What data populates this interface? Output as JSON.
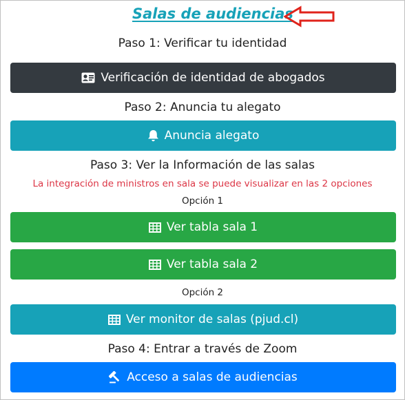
{
  "page": {
    "title": "Salas de audiencias",
    "colors": {
      "title": "#17a2b8",
      "arrow": "#e0231b",
      "note": "#dc3545",
      "dark": "#343a40",
      "info": "#17a2b8",
      "success": "#28a745",
      "primary": "#007bff"
    }
  },
  "step1": {
    "heading": "Paso 1: Verificar tu identidad",
    "button": {
      "label": "Verificación de identidad de abogados",
      "icon": "id-card-icon"
    }
  },
  "step2": {
    "heading": "Paso 2: Anuncia tu alegato",
    "button": {
      "label": "Anuncia alegato",
      "icon": "bell-icon"
    }
  },
  "step3": {
    "heading": "Paso 3: Ver la Información de las salas",
    "note": "La integración de ministros en sala se puede visualizar en las 2 opciones",
    "option1": {
      "label": "Opción 1",
      "buttons": [
        {
          "label": "Ver tabla sala 1",
          "icon": "table-icon"
        },
        {
          "label": "Ver tabla sala 2",
          "icon": "table-icon"
        }
      ]
    },
    "option2": {
      "label": "Opción 2",
      "button": {
        "label": "Ver monitor de salas (pjud.cl)",
        "icon": "table-icon"
      }
    }
  },
  "step4": {
    "heading": "Paso 4: Entrar a través de Zoom",
    "button": {
      "label": "Acceso a salas de audiencias",
      "icon": "gavel-icon"
    }
  }
}
